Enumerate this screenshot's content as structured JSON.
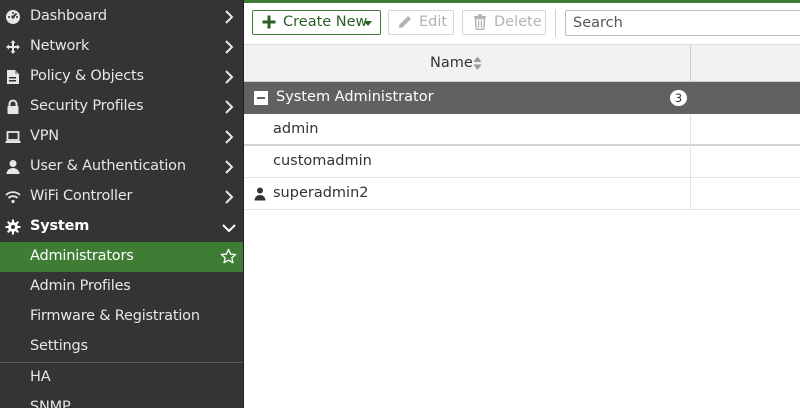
{
  "sidebar": {
    "items": [
      {
        "label": "Dashboard",
        "icon": "dashboard-icon"
      },
      {
        "label": "Network",
        "icon": "network-icon"
      },
      {
        "label": "Policy & Objects",
        "icon": "policy-icon"
      },
      {
        "label": "Security Profiles",
        "icon": "lock-icon"
      },
      {
        "label": "VPN",
        "icon": "laptop-icon"
      },
      {
        "label": "User & Authentication",
        "icon": "user-icon"
      },
      {
        "label": "WiFi Controller",
        "icon": "wifi-icon"
      },
      {
        "label": "System",
        "icon": "gear-icon",
        "expanded": true
      },
      {
        "label": "Administrators",
        "active": true,
        "icon": "star-icon"
      },
      {
        "label": "Admin Profiles"
      },
      {
        "label": "Firmware & Registration"
      },
      {
        "label": "Settings"
      },
      {
        "label": "HA"
      },
      {
        "label": "SNMP"
      }
    ]
  },
  "toolbar": {
    "create_label": "Create New",
    "edit_label": "Edit",
    "delete_label": "Delete",
    "search_placeholder": "Search"
  },
  "table": {
    "columns": [
      "Name"
    ],
    "group": {
      "label": "System Administrator",
      "count": "3"
    },
    "rows": [
      {
        "name": "admin"
      },
      {
        "name": "customadmin"
      },
      {
        "name": "superadmin2",
        "icon": "user-icon"
      }
    ]
  },
  "colors": {
    "accent": "#3f7d35",
    "sidebar_bg": "#343434",
    "group_bg": "#616161"
  }
}
